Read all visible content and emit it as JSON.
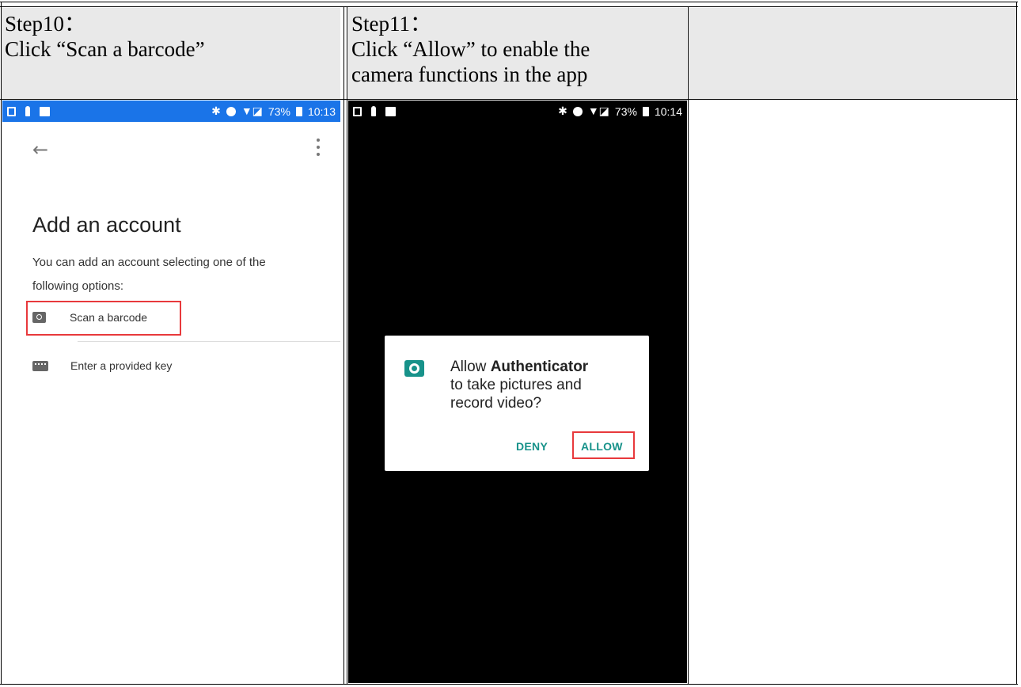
{
  "header": {
    "step10_title": "Step10：",
    "step10_text": "Click “Scan a barcode”",
    "step11_title": "Step11：",
    "step11_line1": "Click “Allow” to enable the",
    "step11_line2": "camera functions in the app"
  },
  "phone1": {
    "status": {
      "battery": "73%",
      "time": "10:13",
      "bar_color": "#1a74e8"
    },
    "title": "Add an account",
    "description_line1": "You can add an account selecting one of the",
    "description_line2": "following options:",
    "options": [
      {
        "label": "Scan a barcode",
        "icon": "camera-icon",
        "highlighted": true
      },
      {
        "label": "Enter a provided key",
        "icon": "keyboard-icon",
        "highlighted": false
      }
    ]
  },
  "phone2": {
    "status": {
      "battery": "73%",
      "time": "10:14"
    },
    "dialog": {
      "prefix": "Allow ",
      "app_name": "Authenticator",
      "line2": "to take pictures and",
      "line3": "record video?",
      "deny_label": "DENY",
      "allow_label": "ALLOW",
      "accent_color": "#17928a"
    }
  },
  "colors": {
    "highlight": "#e8393c",
    "header_bg": "#e9e9e9"
  }
}
